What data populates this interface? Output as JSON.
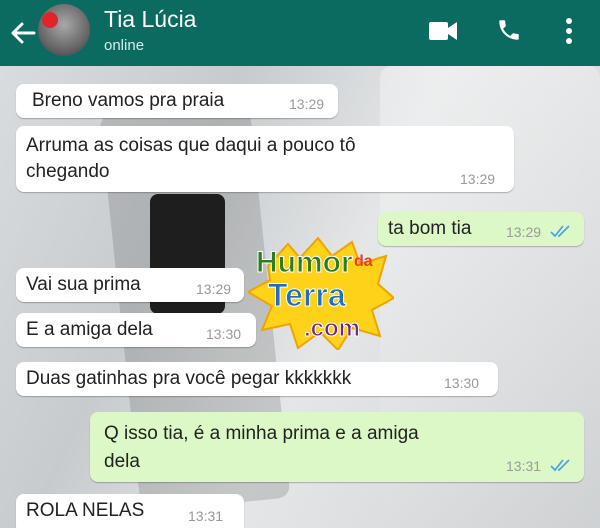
{
  "header": {
    "contact_name": "Tia Lúcia",
    "status": "online",
    "icons": [
      "back-arrow-icon",
      "video-call-icon",
      "phone-icon",
      "more-vertical-icon"
    ],
    "color": "#0b6b60"
  },
  "messages": [
    {
      "dir": "in",
      "text": "Breno vamos pra praia",
      "time": "13:29"
    },
    {
      "dir": "in",
      "text_line1": "Arruma as coisas que daqui a pouco tô",
      "text_line2": "chegando",
      "time": "13:29"
    },
    {
      "dir": "out",
      "text": "ta bom tia",
      "time": "13:29",
      "status": "read"
    },
    {
      "dir": "in",
      "text": "Vai sua prima",
      "time": "13:29"
    },
    {
      "dir": "in",
      "text": "E a amiga dela",
      "time": "13:30"
    },
    {
      "dir": "in",
      "text": "Duas gatinhas pra você pegar kkkkkkk",
      "time": "13:30"
    },
    {
      "dir": "out",
      "text_line1": "Q isso tia, é a minha prima e a amiga",
      "text_line2": "dela",
      "time": "13:31",
      "status": "read"
    },
    {
      "dir": "in",
      "text": "ROLA NELAS",
      "time": "13:31"
    }
  ],
  "watermark": {
    "line1": "Humor",
    "line1b": "da",
    "line2": "Terra",
    "line3": ".com"
  },
  "colors": {
    "incoming": "#ffffff",
    "outgoing": "#dcf8c6",
    "read_ticks": "#4fa3e0"
  }
}
